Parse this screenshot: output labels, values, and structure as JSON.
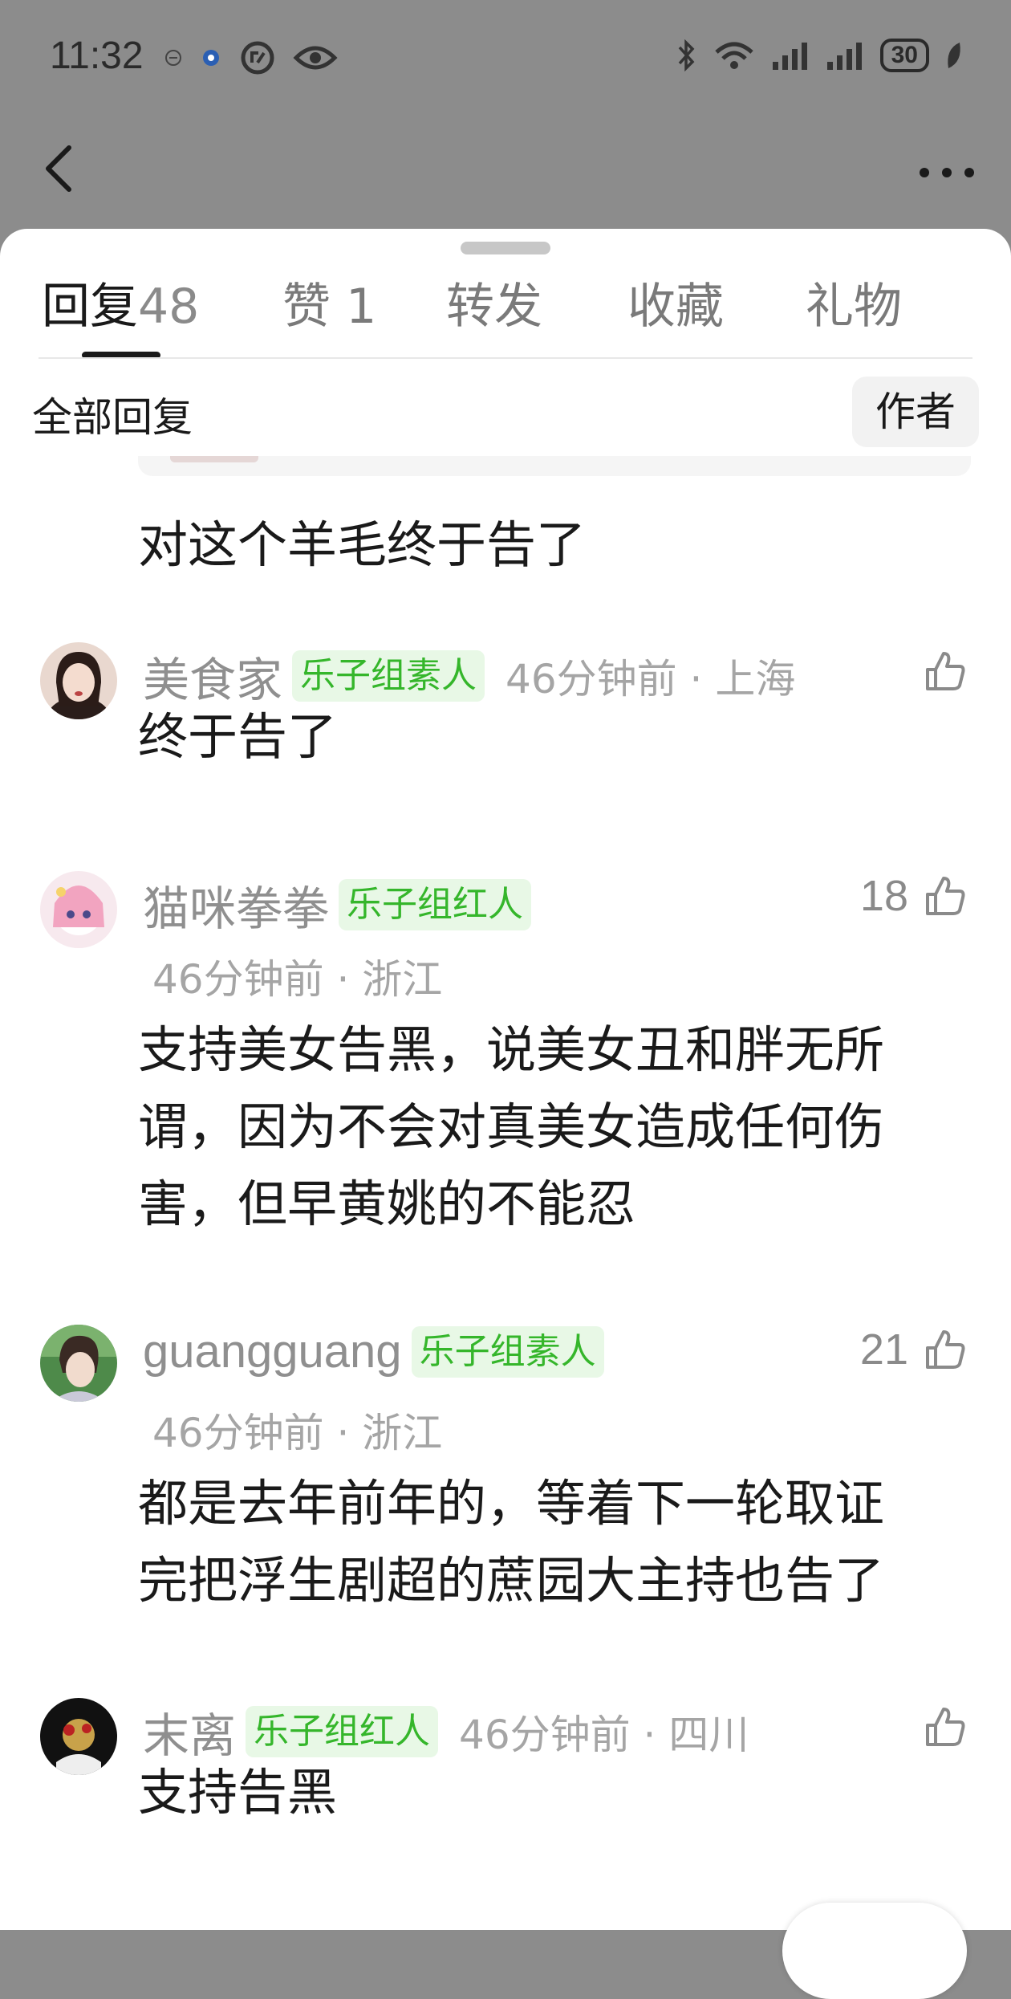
{
  "status_bar": {
    "time": "11:32",
    "battery": "30"
  },
  "tabs": [
    {
      "label": "回复",
      "count": "48"
    },
    {
      "label": "赞",
      "count": "1"
    },
    {
      "label": "转发",
      "count": ""
    },
    {
      "label": "收藏",
      "count": ""
    },
    {
      "label": "礼物",
      "count": ""
    }
  ],
  "filter": {
    "title": "全部回复",
    "author_button": "作者"
  },
  "first_comment_tail": "对这个羊毛终于告了",
  "comments": [
    {
      "name": "美食家",
      "badge": "乐子组素人",
      "time_location": "46分钟前 · 上海",
      "likes": "",
      "text": "终于告了"
    },
    {
      "name": "猫咪拳拳",
      "badge": "乐子组红人",
      "time_location": "46分钟前 · 浙江",
      "likes": "18",
      "text_lines": [
        "支持美女告黑，说美女丑和胖无所",
        "谓，因为不会对真美女造成任何伤",
        "害，但早黄姚的不能忍"
      ]
    },
    {
      "name": "guangguang",
      "badge": "乐子组素人",
      "time_location": "46分钟前 · 浙江",
      "likes": "21",
      "text_lines": [
        "都是去年前年的，等着下一轮取证",
        "完把浮生剧超的蔗园大主持也告了"
      ]
    },
    {
      "name": "末离",
      "badge": "乐子组红人",
      "time_location": "46分钟前 · 四川",
      "likes": "",
      "text": "支持告黑"
    }
  ],
  "icons": {
    "back": "back-arrow-icon",
    "more": "more-dots-icon",
    "like": "thumb-up-icon"
  }
}
